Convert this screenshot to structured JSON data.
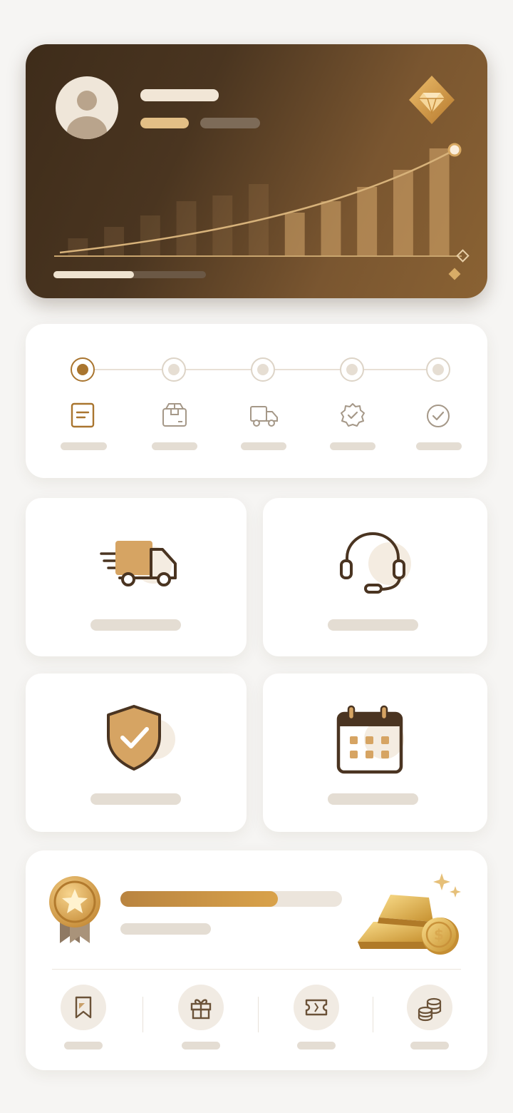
{
  "theme": {
    "accent": "#a9752f",
    "gold": "#d9a24a",
    "dark": "#3e2c1a",
    "placeholder": "#e4ddd3"
  },
  "hero": {
    "badge_icon": "diamond-icon",
    "chart_data": {
      "type": "bar",
      "values": [
        0.12,
        0.2,
        0.28,
        0.38,
        0.42,
        0.5,
        0.3,
        0.38,
        0.48,
        0.6,
        0.75
      ],
      "trend": "rising"
    },
    "progress": 0.53
  },
  "order_tracker": {
    "active_step": 0,
    "steps": [
      {
        "icon": "document-icon"
      },
      {
        "icon": "package-icon"
      },
      {
        "icon": "truck-icon"
      },
      {
        "icon": "verified-badge-icon"
      },
      {
        "icon": "check-circle-icon"
      }
    ]
  },
  "services": [
    {
      "icon": "delivery-truck-icon"
    },
    {
      "icon": "headset-icon"
    },
    {
      "icon": "shield-check-icon"
    },
    {
      "icon": "calendar-icon"
    }
  ],
  "rewards": {
    "medal_icon": "star-medal-icon",
    "progress": 0.71,
    "illustration": "gold-bars-coins",
    "actions": [
      {
        "icon": "bookmark-icon"
      },
      {
        "icon": "gift-icon"
      },
      {
        "icon": "ticket-icon"
      },
      {
        "icon": "coins-icon"
      }
    ]
  }
}
